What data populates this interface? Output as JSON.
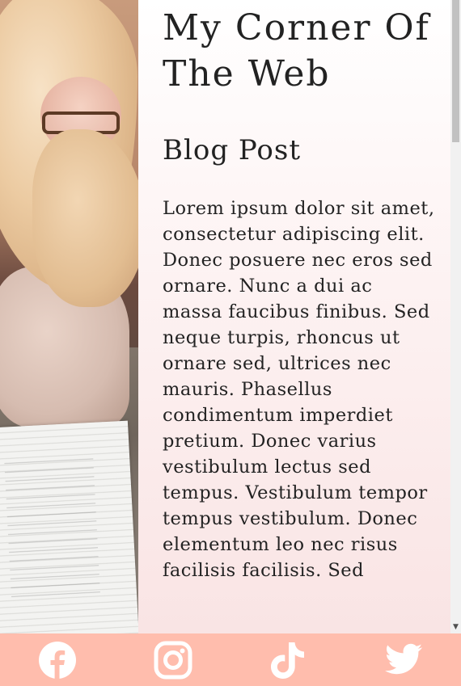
{
  "site": {
    "title": "My Corner Of The Web"
  },
  "post": {
    "heading": "Blog Post",
    "body": "Lorem ipsum dolor sit amet, consectetur adipiscing elit. Donec posuere nec eros sed ornare. Nunc a dui ac massa faucibus finibus. Sed neque turpis, rhoncus ut ornare sed, ultrices nec mauris. Phasellus condimentum imperdiet pretium. Donec varius vestibulum lectus sed tempus. Vestibulum tempor tempus vestibulum. Donec elementum leo nec risus facilisis facilisis. Sed"
  },
  "photo": {
    "icon": "woman-reading-photo"
  },
  "footer": {
    "background": "#ffbdad",
    "icon_color": "#ffffff",
    "links": [
      {
        "icon": "facebook-icon"
      },
      {
        "icon": "instagram-icon"
      },
      {
        "icon": "tiktok-icon"
      },
      {
        "icon": "twitter-icon"
      }
    ]
  },
  "colors": {
    "text": "#222222",
    "accent": "#ffbdad"
  }
}
